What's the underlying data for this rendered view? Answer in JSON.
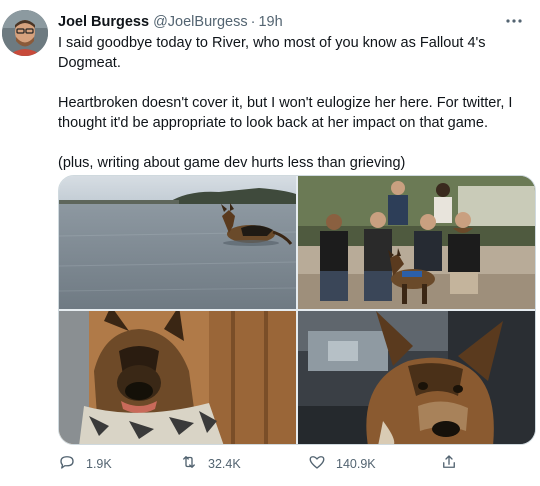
{
  "tweet": {
    "author_name": "Joel Burgess",
    "author_handle": "@JoelBurgess",
    "separator": "·",
    "time": "19h",
    "paragraphs": [
      "I said goodbye today to River, who most of you know as Fallout 4's\nDogmeat.",
      "Heartbroken doesn't cover it, but I won't eulogize her here. For twitter, I\nthought it'd be appropriate to look back at her impact on that game.",
      "(plus, writing about game dev hurts less than grieving)"
    ],
    "media": [
      {
        "name": "dog-in-lake-photo"
      },
      {
        "name": "group-with-dog-photo"
      },
      {
        "name": "dog-with-bandana-photo"
      },
      {
        "name": "dog-in-car-photo"
      }
    ],
    "actions": {
      "replies": "1.9K",
      "retweets": "32.4K",
      "likes": "140.9K"
    }
  },
  "icons": {
    "reply": "reply-icon",
    "retweet": "retweet-icon",
    "like": "heart-icon",
    "share": "share-icon",
    "more": "more-icon"
  },
  "colors": {
    "text": "#0f1419",
    "secondary": "#536471",
    "border": "#cfd9de"
  }
}
